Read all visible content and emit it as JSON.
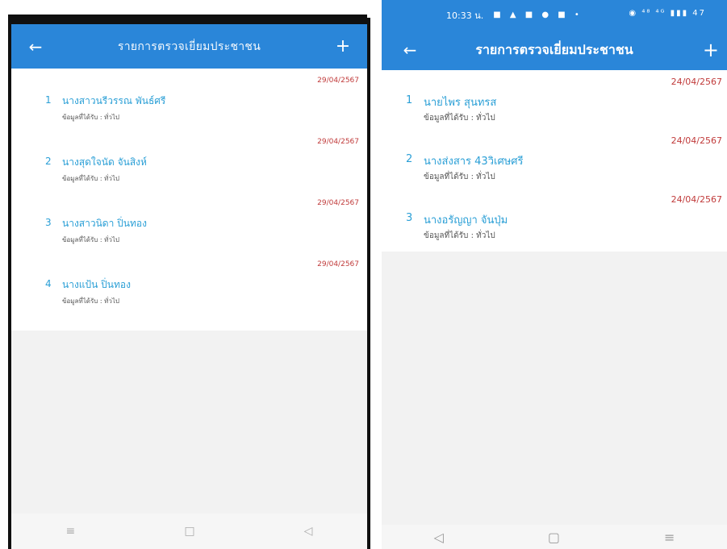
{
  "colors": {
    "primary": "#2a86d9",
    "accent_text": "#2a9fd6",
    "date_red": "#c03a3a",
    "list_bg": "#ffffff",
    "screen_bg": "#f2f2f2"
  },
  "left_phone": {
    "title": "รายการตรวจเยี่ยมประชาชน",
    "back_icon": "arrow-left-icon",
    "add_icon": "plus-icon",
    "items": [
      {
        "number": "1",
        "name": "นางสาวนรีวรรณ พันธ์ศรี",
        "info": "ข้อมูลที่ได้รับ : ทั่วไป",
        "date": "29/04/2567"
      },
      {
        "number": "2",
        "name": "นางสุดใจนัด จันสิงห์",
        "info": "ข้อมูลที่ได้รับ : ทั่วไป",
        "date": "29/04/2567"
      },
      {
        "number": "3",
        "name": "นางสาวนิดา ปิ่นทอง",
        "info": "ข้อมูลที่ได้รับ : ทั่วไป",
        "date": "29/04/2567"
      },
      {
        "number": "4",
        "name": "นางแป้น ปิ่นทอง",
        "info": "ข้อมูลที่ได้รับ : ทั่วไป",
        "date": "29/04/2567"
      }
    ],
    "nav": {
      "menu": "≡",
      "home": "□",
      "back": "◁"
    }
  },
  "right_phone": {
    "status_time": "10:33 น.",
    "status_icons": "■ ▲ ■ ● ■ •",
    "status_right": "◉ ⁴⁸ ⁴ᴳ ▮▮▮ 47",
    "title": "รายการตรวจเยี่ยมประชาชน",
    "back_icon": "arrow-left-icon",
    "add_icon": "plus-icon",
    "items": [
      {
        "number": "1",
        "name": "นายไพร สุนทรส",
        "info": "ข้อมูลที่ได้รับ : ทั่วไป",
        "date": "24/04/2567"
      },
      {
        "number": "2",
        "name": "นางส่งสาร 43วิเศษศรี",
        "info": "ข้อมูลที่ได้รับ : ทั่วไป",
        "date": "24/04/2567"
      },
      {
        "number": "3",
        "name": "นางอรัญญา จันปุ่ม",
        "info": "ข้อมูลที่ได้รับ : ทั่วไป",
        "date": "24/04/2567"
      }
    ],
    "nav": {
      "back": "◁",
      "home": "▢",
      "menu": "≡"
    }
  }
}
